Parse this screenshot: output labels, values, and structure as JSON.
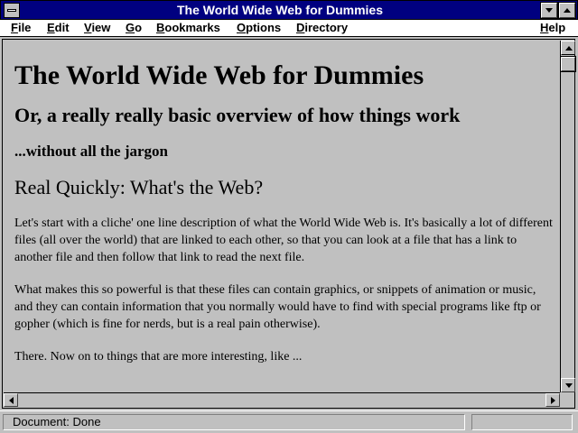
{
  "window": {
    "title": "The World Wide Web for Dummies"
  },
  "menu": {
    "items": [
      {
        "label": "File",
        "accel": "F"
      },
      {
        "label": "Edit",
        "accel": "E"
      },
      {
        "label": "View",
        "accel": "V"
      },
      {
        "label": "Go",
        "accel": "G"
      },
      {
        "label": "Bookmarks",
        "accel": "B"
      },
      {
        "label": "Options",
        "accel": "O"
      },
      {
        "label": "Directory",
        "accel": "D"
      },
      {
        "label": "Help",
        "accel": "H"
      }
    ]
  },
  "page": {
    "heading": "The World Wide Web for Dummies",
    "subheading": "Or, a really really basic overview of how things work",
    "tagline": "...without all the jargon",
    "section_title": "Real Quickly: What's the Web?",
    "paragraphs": [
      "Let's start with a cliche' one line description of what the World Wide Web is. It's basically a lot of different files (all over the world) that are linked to each other, so that you can look at a file that has a link to another file and then follow that link to read the next file.",
      "What makes this so powerful is that these files can contain graphics, or snippets of animation or music, and they can contain information that you normally would have to find with special programs like ftp or gopher (which is fine for nerds, but is a real pain otherwise).",
      "There. Now on to things that are more interesting, like ..."
    ]
  },
  "status": {
    "text": "Document: Done"
  },
  "colors": {
    "title_bar": "#000080",
    "window_bg": "#c0c0c0",
    "menu_bg": "#ffffff"
  },
  "icons": [
    "system-menu-icon",
    "minimize-icon",
    "maximize-icon",
    "scroll-up-icon",
    "scroll-down-icon",
    "scroll-left-icon",
    "scroll-right-icon"
  ]
}
